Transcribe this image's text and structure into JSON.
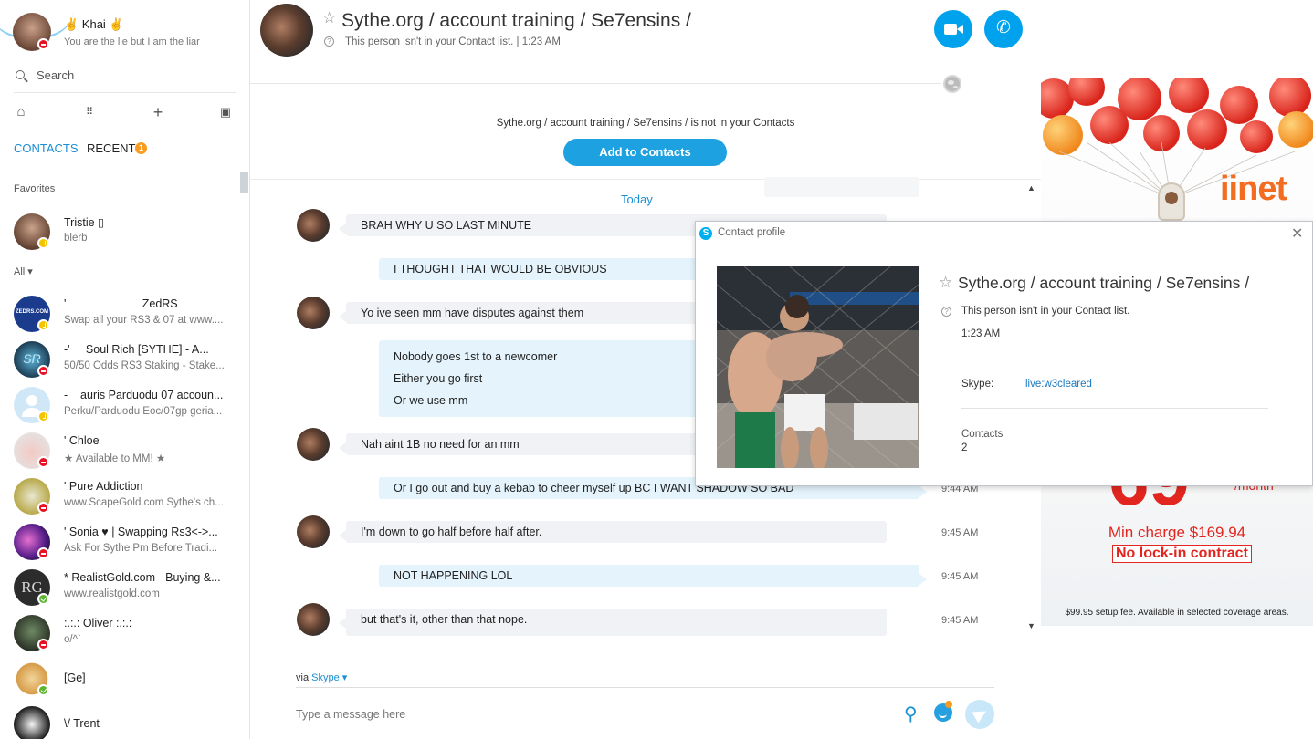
{
  "me": {
    "name": "✌ Khai ✌",
    "mood": "You are the lie but I am the liar"
  },
  "search": {
    "placeholder": "Search"
  },
  "tabs": {
    "contacts": "CONTACTS",
    "recent": "RECENT",
    "recent_badge": "1"
  },
  "sections": {
    "favorites": "Favorites",
    "all": "All ▾"
  },
  "favorites": [
    {
      "name": "Tristie ▯",
      "sub": "blerb",
      "status": "away"
    }
  ],
  "contacts": [
    {
      "name": "'                        ZedRS",
      "sub": "Swap all your RS3 & 07 at www....",
      "status": "away",
      "avatar_text": "ZEDRS.COM"
    },
    {
      "name": "-'     Soul Rich [SYTHE] - A...",
      "sub": "50/50 Odds RS3 Staking - Stake...",
      "status": "dnd",
      "avatar_text": "SR"
    },
    {
      "name": "-    auris Parduodu 07 accoun...",
      "sub": "Perku/Parduodu Eoc/07gp geria...",
      "status": "away",
      "avatar_text": ""
    },
    {
      "name": "' Chloe",
      "sub": "★ Available to MM! ★",
      "status": "dnd",
      "avatar_text": ""
    },
    {
      "name": "' Pure Addiction",
      "sub": "www.ScapeGold.com Sythe's ch...",
      "status": "dnd",
      "avatar_text": ""
    },
    {
      "name": "' Sonia ♥ | Swapping Rs3<->...",
      "sub": "Ask For Sythe Pm Before Tradi...",
      "status": "dnd",
      "avatar_text": ""
    },
    {
      "name": "* RealistGold.com - Buying &...",
      "sub": "www.realistgold.com",
      "status": "online",
      "avatar_text": "RG"
    },
    {
      "name": ":.:.: Oliver :.:.:",
      "sub": "o/^`",
      "status": "dnd",
      "avatar_text": ""
    },
    {
      "name": "[Ge]",
      "sub": "",
      "status": "online",
      "avatar_text": ""
    },
    {
      "name": "\\/ Trent",
      "sub": "",
      "status": "none",
      "avatar_text": ""
    }
  ],
  "chat": {
    "title": "Sythe.org / account training / Se7ensins /",
    "subtitle": "This person isn't in your Contact list.  |  1:23 AM",
    "notice": "Sythe.org / account training / Se7ensins / is not in your Contacts",
    "add_button": "Add to Contacts",
    "day_label": "Today",
    "messages": [
      {
        "dir": "in",
        "lines": [
          "BRAH WHY U SO LAST MINUTE"
        ],
        "time": ""
      },
      {
        "dir": "out",
        "lines": [
          "I THOUGHT THAT WOULD BE OBVIOUS"
        ],
        "time": ""
      },
      {
        "dir": "in",
        "lines": [
          "Yo ive seen mm have disputes against them"
        ],
        "time": ""
      },
      {
        "dir": "out",
        "lines": [
          "Nobody goes 1st to a newcomer",
          "Either you go first",
          "Or we use mm"
        ],
        "time": ""
      },
      {
        "dir": "in",
        "lines": [
          "Nah aint 1B no need for an mm"
        ],
        "time": ""
      },
      {
        "dir": "out",
        "lines": [
          "Or I go out and buy a kebab to cheer myself up BC I WANT SHADOW SO BAD"
        ],
        "time": "9:44 AM"
      },
      {
        "dir": "in",
        "lines": [
          "I'm down to go half before half after."
        ],
        "time": "9:45 AM"
      },
      {
        "dir": "out",
        "lines": [
          "NOT HAPPENING LOL"
        ],
        "time": "9:45 AM"
      },
      {
        "dir": "in",
        "lines": [
          "but that's it, other than that nope."
        ],
        "time": "9:45 AM"
      }
    ],
    "via_prefix": "via",
    "via_link": "Skype ▾",
    "compose_placeholder": "Type a message here"
  },
  "ad": {
    "brand_main": "iinet",
    "price": "69",
    "per_month": "/month",
    "min_charge": "Min charge $169.94",
    "no_lock": "No lock-in contract",
    "footer": "$99.95 setup fee. Available in selected coverage areas."
  },
  "profile": {
    "window_title": "Contact profile",
    "name": "Sythe.org / account training / Se7ensins /",
    "not_in_list": "This person isn't in your Contact list.",
    "time": "1:23 AM",
    "skype_label": "Skype:",
    "skype_value": "live:w3cleared",
    "contacts_label": "Contacts",
    "contacts_value": "2"
  },
  "colors": {
    "accent": "#00a2ed",
    "link": "#1a8fd3",
    "badge": "#f89b1e",
    "status_dnd": "#e81123",
    "status_away": "#f5c400",
    "status_online": "#5bb531",
    "bubble_in": "#f0f2f5",
    "bubble_out": "#e4f3fc",
    "ad_red": "#e2261f"
  }
}
